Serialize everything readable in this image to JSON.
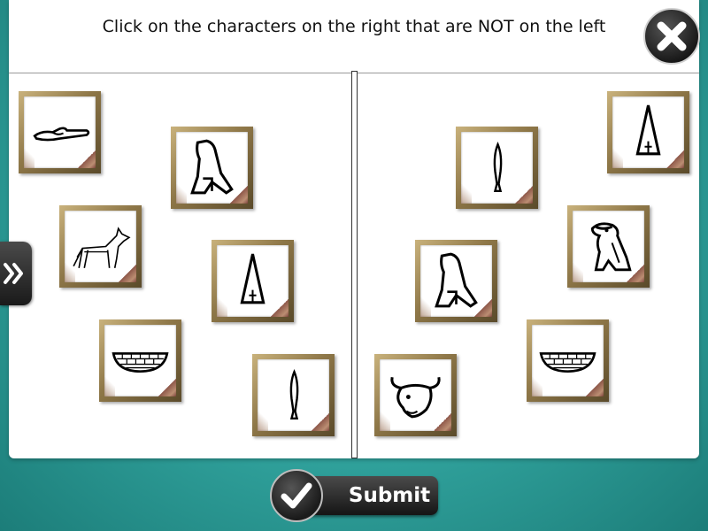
{
  "instruction": "Click on the characters on the right that are NOT on the left",
  "submit": {
    "label": "Submit"
  },
  "left_tiles": [
    {
      "glyph": "hand-glyph"
    },
    {
      "glyph": "vulture-glyph"
    },
    {
      "glyph": "jackal-glyph"
    },
    {
      "glyph": "cone-glyph"
    },
    {
      "glyph": "basket-glyph"
    },
    {
      "glyph": "reed-glyph"
    }
  ],
  "right_tiles": [
    {
      "glyph": "cone-glyph"
    },
    {
      "glyph": "reed-glyph"
    },
    {
      "glyph": "owl-glyph"
    },
    {
      "glyph": "vulture-glyph"
    },
    {
      "glyph": "basket-glyph"
    },
    {
      "glyph": "bull-head-glyph"
    }
  ],
  "icons": {
    "close": "close-icon",
    "expand": "double-chevron-right-icon",
    "check": "checkmark-icon"
  },
  "colors": {
    "background": "#34a9a3",
    "frame": "#8e7748"
  }
}
